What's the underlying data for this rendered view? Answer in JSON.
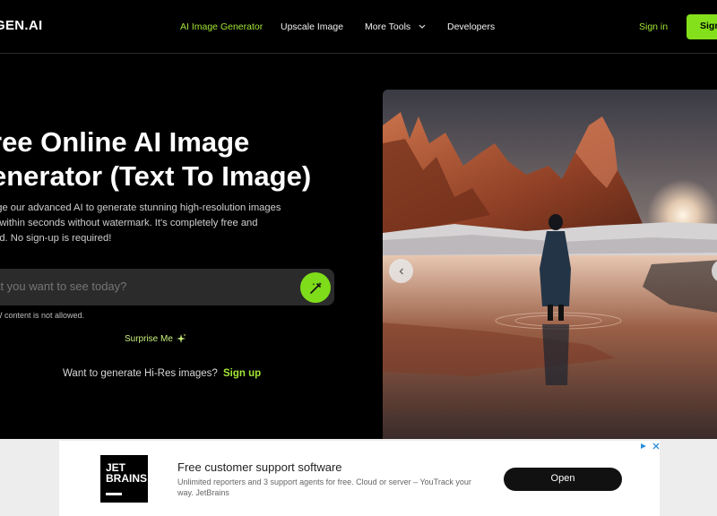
{
  "nav": {
    "logo": "GEN.AI",
    "links": [
      {
        "label": "AI Image Generator",
        "active": true
      },
      {
        "label": "Upscale Image",
        "active": false
      },
      {
        "label": "More Tools",
        "active": false
      },
      {
        "label": "Developers",
        "active": false
      }
    ],
    "signin": "Sign in",
    "signup": "Sign up"
  },
  "hero": {
    "title_line1": "ree Online AI Image",
    "title_line2": "enerator (Text To Image)",
    "subtext_line1": "age our advanced AI to generate stunning high-resolution images",
    "subtext_line2": "u within seconds without watermark. It's completely free and",
    "subtext_line3": "ted. No sign-up is required!",
    "prompt_placeholder": "hat you want to see today?",
    "nsfw_note": "W content is not allowed.",
    "surprise": "Surprise Me",
    "hires_text": "Want to generate Hi-Res images?",
    "hires_link": "Sign up"
  },
  "ad": {
    "logo_line1": "JET",
    "logo_line2": "BRAINS",
    "title": "Free customer support software",
    "desc": "Unlimited reporters and 3 support agents for free. Cloud or server – YouTrack your way. JetBrains",
    "cta": "Open"
  },
  "colors": {
    "accent": "#a3e635",
    "button_green": "#84e01b",
    "background": "#000000",
    "input_bg": "#2b2b2b"
  },
  "icons": [
    "chevron-down-icon",
    "magic-wand-icon",
    "sparkle-icon",
    "arrow-left-icon",
    "ad-choices-icon",
    "close-icon"
  ]
}
